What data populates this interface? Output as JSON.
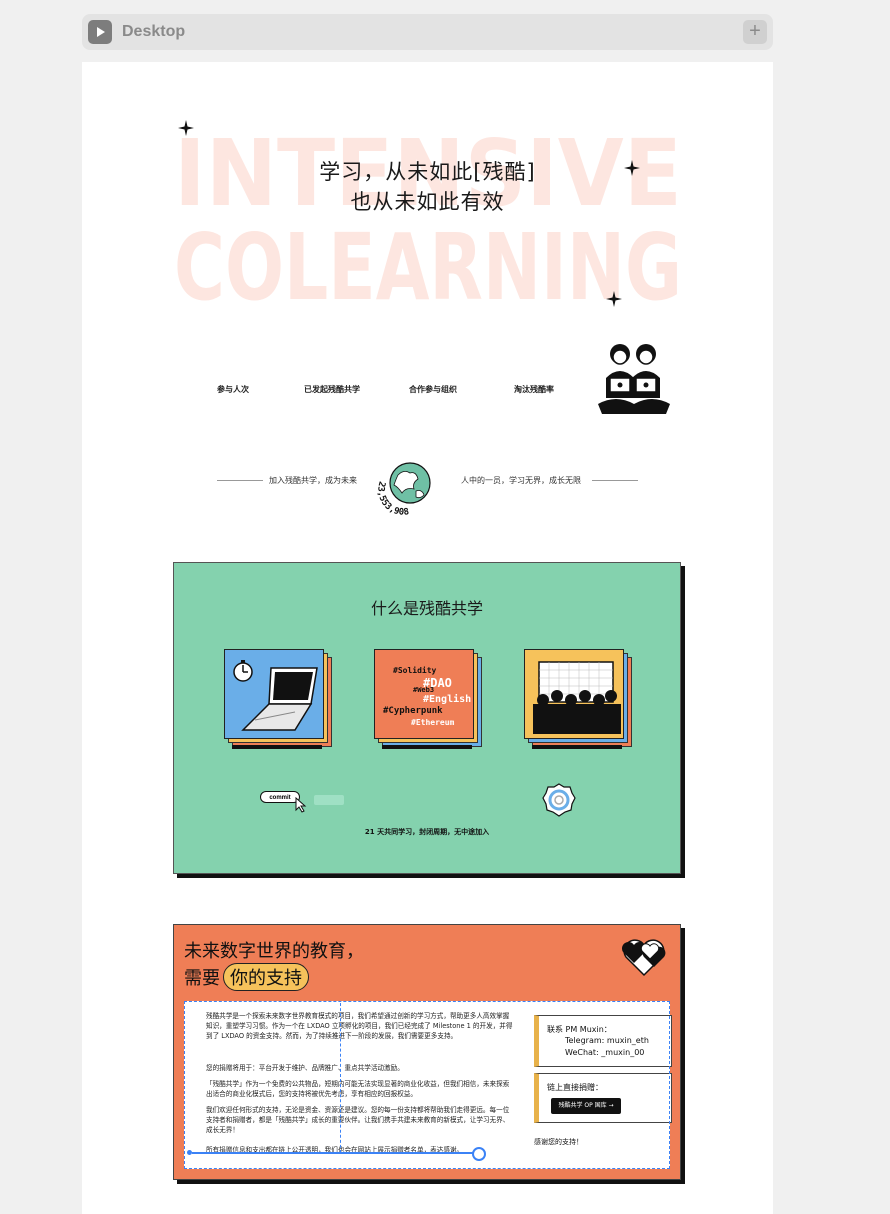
{
  "window": {
    "tab_title": "Desktop",
    "add_symbol": "+"
  },
  "hero": {
    "background_words": [
      "INTENSIVE",
      "COLEARNING"
    ],
    "title_line1": "学习，从未如此[残酷]",
    "title_line2": "也从未如此有效"
  },
  "stats": {
    "items": [
      {
        "label": "参与人次"
      },
      {
        "label": "已发起残酷共学"
      },
      {
        "label": "合作参与组织"
      },
      {
        "label": "淘汰残酷率"
      }
    ]
  },
  "join": {
    "left_text": "加入残酷共学，成为未来",
    "counter": "23,553,908",
    "right_text": "人中的一员，学习无界，成长无限"
  },
  "what": {
    "title": "什么是残酷共学",
    "tags": [
      "#Solidity",
      "#DAO",
      "#Web3",
      "#English",
      "#Cypherpunk",
      "#Ethereum"
    ],
    "commit_label": "commit",
    "footer": "21 天共同学习，封闭周期，无中途加入"
  },
  "support": {
    "title_line1": "未来数字世界的教育，",
    "title_line2_prefix": "需要",
    "title_highlight": "你的支持",
    "paragraphs": [
      "残酷共学是一个探索未来数字世界教育模式的项目，我们希望通过创新的学习方式，帮助更多人高效掌握知识，重塑学习习惯。作为一个在 LXDAO 立项孵化的项目，我们已经完成了 Milestone 1 的开发，并得到了 LXDAO 的资金支持。然而，为了持续推进下一阶段的发展，我们需要更多支持。",
      "您的捐赠将用于：平台开发于维护、品牌推广、重点共学活动激励。",
      "「残酷共学」作为一个免费的公共物品，短期内可能无法实现显著的商业化收益，但我们相信，未来探索出适合的商业化模式后，您的支持将被优先考虑，享有相应的回报权益。",
      "我们欢迎任何形式的支持，无论是资金、资源还是建议。您的每一份支持都将帮助我们走得更远。每一位支持者和捐赠者，都是「残酷共学」成长的重要伙伴。让我们携手共建未来教育的新模式，让学习无界、成长无界！",
      "所有捐赠信息和支出都在链上公开透明，我们也会在网站上展示捐赠者名单，表达感谢。"
    ],
    "contact_title": "联系 PM Muxin：",
    "telegram": "Telegram: muxin_eth",
    "wechat": "WeChat: _muxin_00",
    "donate_title": "链上直接捐赠：",
    "donate_button": "残酷共学 OP 国库 →",
    "thanks": "感谢您的支持！"
  },
  "colors": {
    "green": "#84d2ae",
    "orange": "#ef7e56",
    "yellow": "#f6c25b",
    "selection": "#3b82f6"
  }
}
